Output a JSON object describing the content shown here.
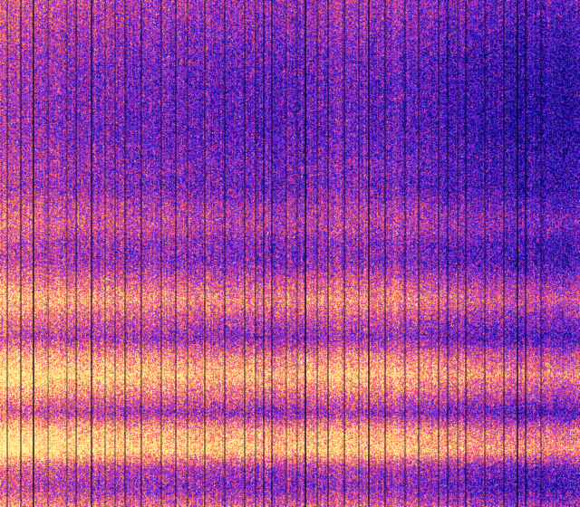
{
  "chart_data": {
    "type": "heatmap",
    "title": "",
    "xlabel": "",
    "ylabel": "",
    "colormap": [
      "#08045c",
      "#1a0fa0",
      "#3c1fd0",
      "#8a2bd8",
      "#d43fa6",
      "#ff5f6e",
      "#ffb050",
      "#fff29a"
    ],
    "value_range": [
      0,
      1
    ],
    "rows": 28,
    "columns": 64,
    "row_profile": [
      0.45,
      0.42,
      0.38,
      0.34,
      0.32,
      0.31,
      0.3,
      0.3,
      0.33,
      0.36,
      0.34,
      0.46,
      0.52,
      0.4,
      0.4,
      0.58,
      0.74,
      0.56,
      0.42,
      0.72,
      0.88,
      0.68,
      0.44,
      0.82,
      0.92,
      0.48,
      0.4,
      0.62
    ],
    "column_profile": [
      0.22,
      0.2,
      0.18,
      0.17,
      0.16,
      0.14,
      0.13,
      0.12,
      0.1,
      0.1,
      0.09,
      0.08,
      0.07,
      0.06,
      0.06,
      0.05,
      0.04,
      0.05,
      0.06,
      0.05,
      0.04,
      0.03,
      0.03,
      0.02,
      0.02,
      0.03,
      0.03,
      0.02,
      0.02,
      0.01,
      0.01,
      0.02,
      0.02,
      0.03,
      0.03,
      0.04,
      0.05,
      0.05,
      0.06,
      0.06,
      0.05,
      0.04,
      0.03,
      0.03,
      0.02,
      0.01,
      0.0,
      -0.02,
      -0.03,
      -0.05,
      -0.06,
      -0.07,
      -0.08,
      -0.09,
      -0.1,
      -0.11,
      -0.12,
      -0.13,
      -0.13,
      -0.14,
      -0.14,
      -0.14,
      -0.15,
      -0.15
    ],
    "dark_column_count": 40
  }
}
